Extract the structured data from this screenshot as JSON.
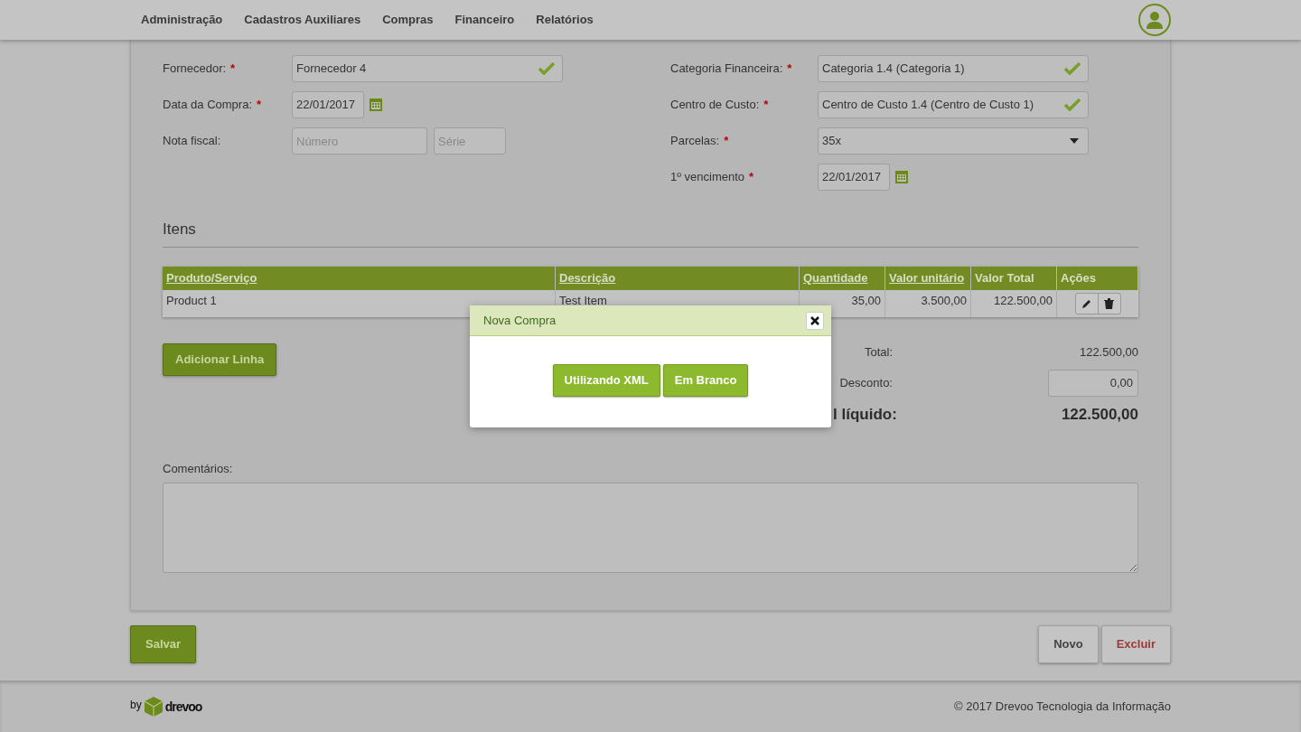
{
  "nav": [
    {
      "label": "Administração"
    },
    {
      "label": "Cadastros Auxiliares"
    },
    {
      "label": "Compras"
    },
    {
      "label": "Financeiro"
    },
    {
      "label": "Relatórios"
    }
  ],
  "form_left": [
    {
      "kind": "text",
      "label": "Fornecedor:",
      "mark": "*",
      "value": "Fornecedor 4",
      "valid": true
    },
    {
      "kind": "date",
      "label": "Data da Compra:",
      "mark": "*",
      "value": "22/01/2017"
    },
    {
      "kind": "pair",
      "label": "Nota fiscal:",
      "placeholders": [
        "Número",
        "Série"
      ]
    }
  ],
  "form_right": [
    {
      "kind": "text",
      "label": "Categoria Financeira:",
      "mark": "*",
      "value": "Categoria 1.4 (Categoria 1)",
      "valid": true
    },
    {
      "kind": "text",
      "label": "Centro de Custo:",
      "mark": "*",
      "value": "Centro de Custo 1.4 (Centro de Custo 1)",
      "valid": true
    },
    {
      "kind": "select",
      "label": "Parcelas:",
      "mark": "*",
      "value": "35x"
    },
    {
      "kind": "date",
      "label": "1º vencimento",
      "mark": "*",
      "value": "22/01/2017"
    }
  ],
  "items": {
    "title": "Itens",
    "columns": [
      {
        "label": "Produto/Serviço",
        "sortable": true
      },
      {
        "label": "Descrição",
        "sortable": true
      },
      {
        "label": "Quantidade",
        "sortable": true
      },
      {
        "label": "Valor unitário",
        "sortable": true
      },
      {
        "label": "Valor Total",
        "sortable": false
      },
      {
        "label": "Ações",
        "sortable": false
      }
    ],
    "rows": [
      {
        "cells": [
          "Product 1",
          "Test Item",
          "35,00",
          "3.500,00",
          "122.500,00"
        ]
      }
    ]
  },
  "add_line_button": "Adicionar Linha",
  "totals": [
    {
      "kind": "text",
      "label": "Total:",
      "value": "122.500,00"
    },
    {
      "kind": "input",
      "label": "Desconto:",
      "value": "0,00"
    },
    {
      "kind": "grand",
      "label": "l líquido:",
      "value": "122.500,00"
    }
  ],
  "comments": {
    "label": "Comentários:"
  },
  "buttons": [
    {
      "label": "Salvar",
      "kind": "primary"
    },
    {
      "label": "Novo",
      "kind": "default"
    },
    {
      "label": "Excluir",
      "kind": "danger"
    }
  ],
  "footer": {
    "by": "by",
    "logo": "drevoo",
    "copyright": "© 2017 Drevoo Tecnologia da Informação"
  },
  "modal": {
    "title": "Nova Compra",
    "buttons": [
      "Utilizando XML",
      "Em Branco"
    ]
  }
}
